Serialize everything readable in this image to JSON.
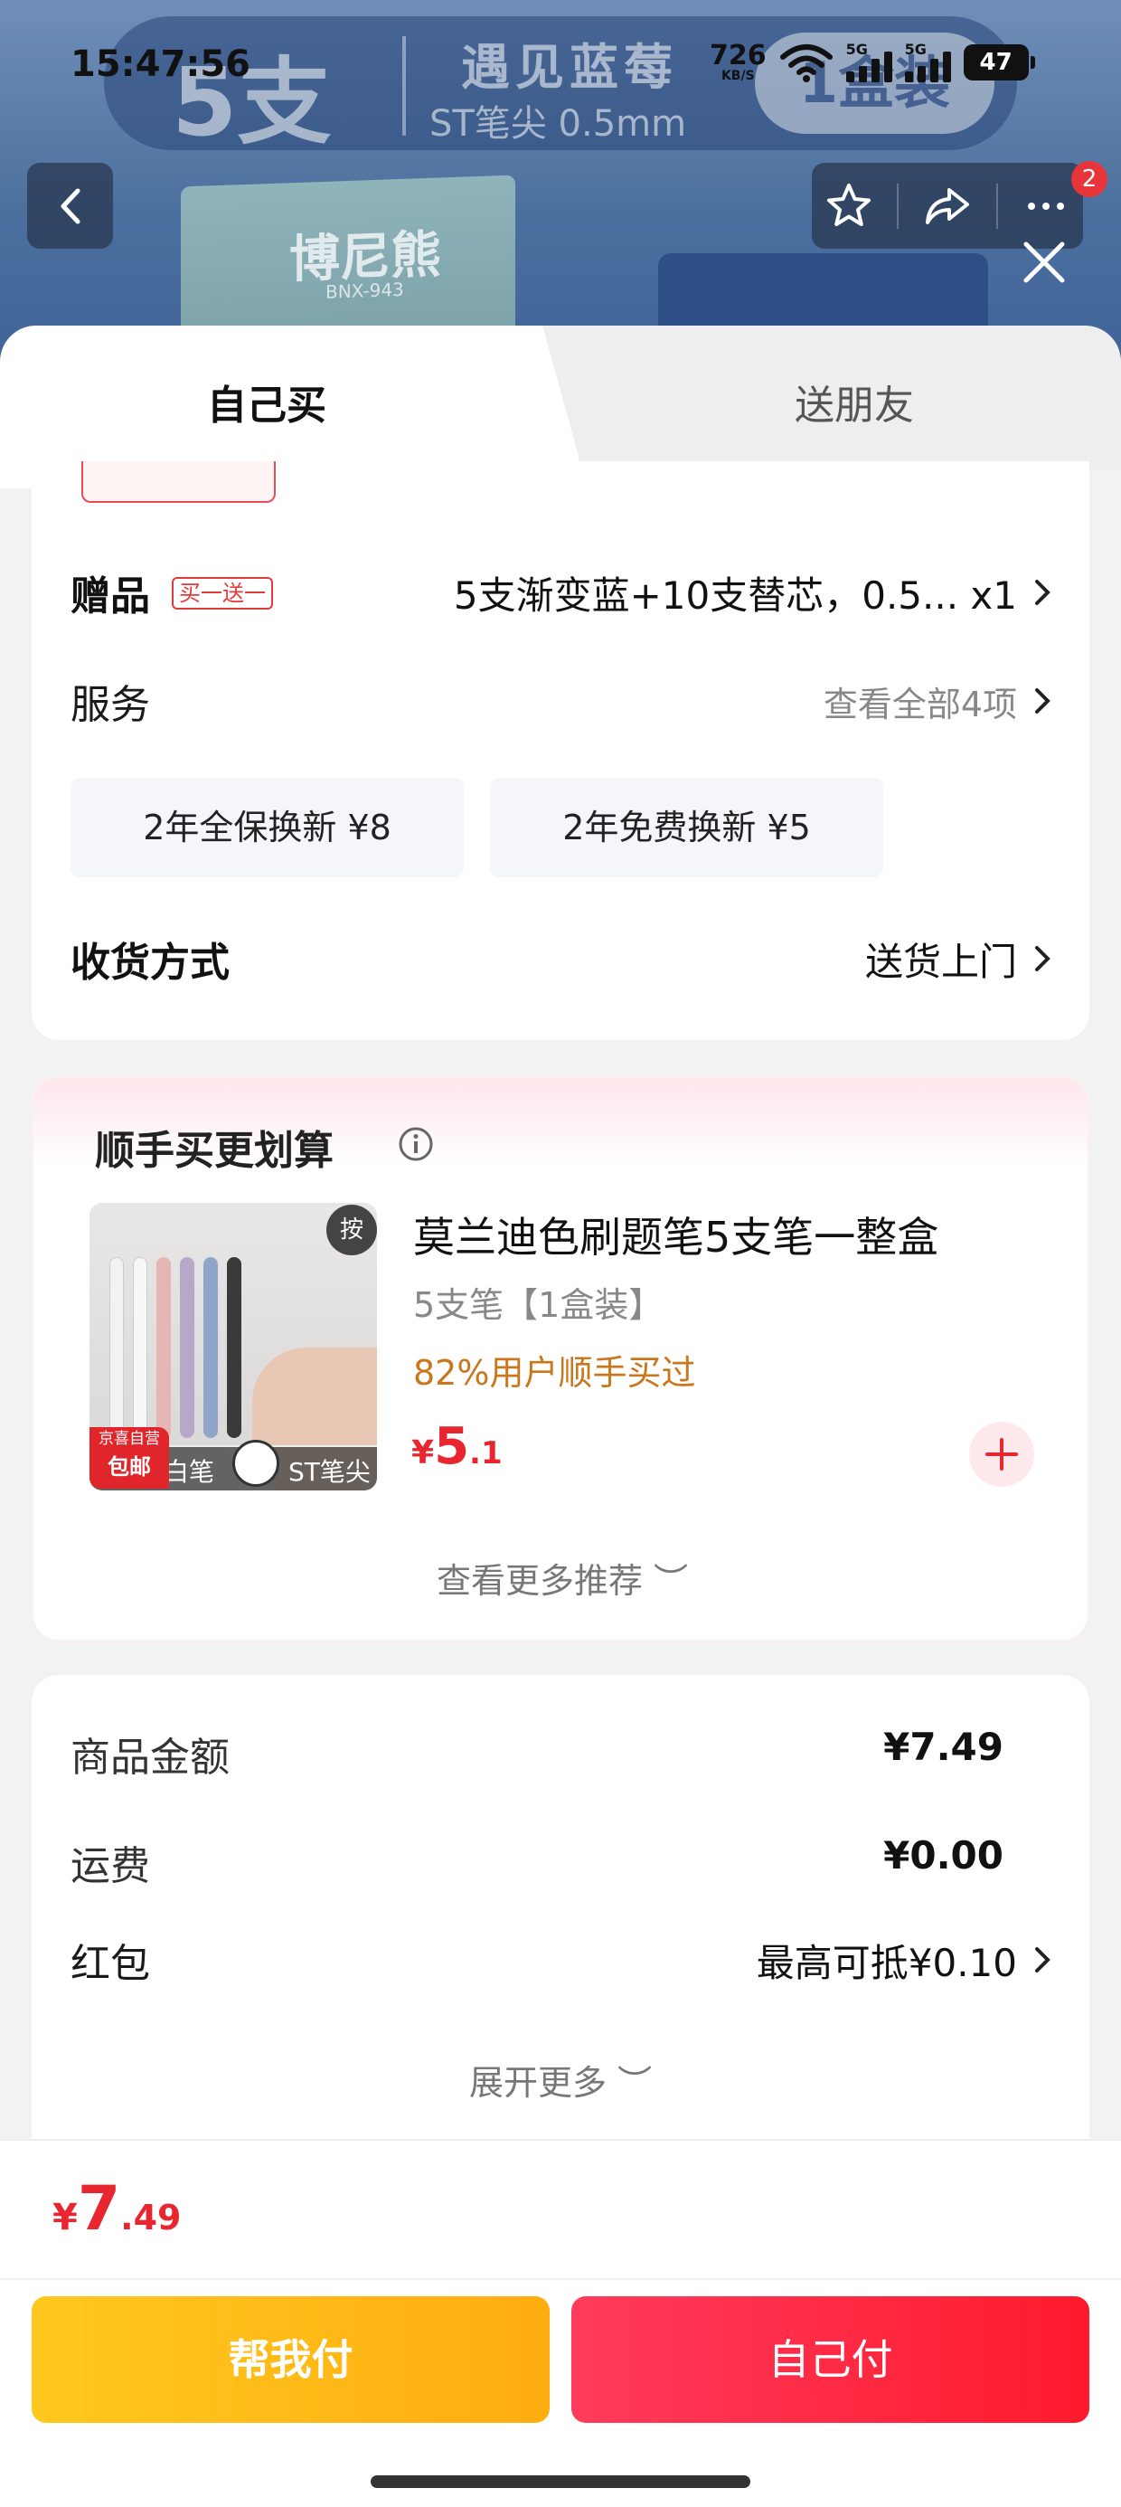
{
  "status_bar": {
    "time": "15:47:56",
    "net_speed_value": "726",
    "net_speed_unit": "KB/S",
    "signal1_tag": "5G",
    "signal2_tag": "5G",
    "battery": "47"
  },
  "background": {
    "banner_big": "5支",
    "banner_line1": "遇见蓝莓",
    "banner_line2": "ST笔尖  0.5mm",
    "banner_pill": "1盒装",
    "box_brand": "博尼熊",
    "box_model": "BNX-943"
  },
  "nav": {
    "back_icon": "chevron-left-icon",
    "favorite_icon": "star-icon",
    "share_icon": "share-icon",
    "more_icon": "more-icon",
    "badge": "2",
    "close_icon": "close-icon"
  },
  "tabs": {
    "self_buy": "自己买",
    "gift_friend": "送朋友"
  },
  "order": {
    "gift_label": "赠品",
    "gift_tag": "买一送一",
    "gift_value": "5支渐变蓝+10支替芯，0.5... x1",
    "service_label": "服务",
    "service_value": "查看全部4项",
    "service_options": [
      "2年全保换新  ¥8",
      "2年免费换新  ¥5"
    ],
    "delivery_label": "收货方式",
    "delivery_value": "送货上门"
  },
  "recommend": {
    "title": "顺手买更划算",
    "item_name": "莫兰迪色刷题笔5支笔一整盒",
    "item_spec": "5支笔【1盒装】",
    "item_stat": "82%用户顺手买过",
    "price_currency": "¥",
    "price_int": "5",
    "price_dec": ".1",
    "img_badge_top": "京喜自营",
    "img_badge_bottom": "包邮",
    "img_label_left": "白笔",
    "img_label_right": "ST笔尖",
    "img_press": "按",
    "more": "查看更多推荐 ︶"
  },
  "totals": {
    "goods_label": "商品金额",
    "goods_value": "¥7.49",
    "shipping_label": "运费",
    "shipping_value": "¥0.00",
    "redpacket_label": "红包",
    "redpacket_value": "最高可抵¥0.10",
    "expand": "展开更多 ︶"
  },
  "bottom": {
    "currency": "¥",
    "price_int": "7",
    "price_dec": ".49",
    "help_pay": "帮我付",
    "self_pay": "自己付"
  },
  "colors": {
    "price_red": "#e8262f",
    "help_btn": "#ffb716",
    "self_btn": "#ff2a40",
    "stat_orange": "#c9771d"
  }
}
